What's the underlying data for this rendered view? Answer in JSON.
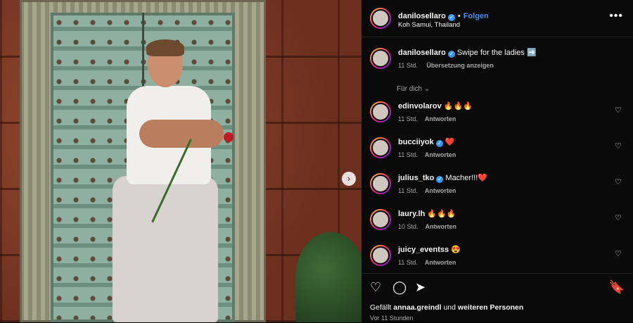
{
  "post": {
    "author": "danilosellaro",
    "follow_label": "Folgen",
    "location": "Koh Samui, Thailand",
    "caption_text": "Swipe for the ladies ➡️",
    "caption_time": "11 Std.",
    "translate_label": "Übersetzung anzeigen",
    "for_you_label": "Für dich ⌄",
    "more_label": "•••"
  },
  "comments": [
    {
      "user": "edinvolarov",
      "verified": false,
      "text": "🔥🔥🔥",
      "time": "11 Std.",
      "reply": "Antworten"
    },
    {
      "user": "bucciiyok",
      "verified": true,
      "text": "❤️",
      "time": "11 Std.",
      "reply": "Antworten"
    },
    {
      "user": "julius_tko",
      "verified": true,
      "text": "Macher!!!❤️",
      "time": "11 Std.",
      "reply": "Antworten"
    },
    {
      "user": "laury.lh",
      "verified": false,
      "text": "🔥🔥🔥",
      "time": "10 Std.",
      "reply": "Antworten"
    },
    {
      "user": "juicy_eventss",
      "verified": false,
      "text": "😍",
      "time": "11 Std.",
      "reply": "Antworten"
    }
  ],
  "footer": {
    "likes_prefix": "Gefällt",
    "likes_user": "annaa.greindl",
    "likes_mid": "und",
    "likes_others": "weiteren Personen",
    "timestamp": "Vor 11 Stunden"
  },
  "icons": {
    "heart": "♡",
    "comment": "◯",
    "share": "➤",
    "save": "🔖",
    "next": "›",
    "verified": "✓"
  },
  "colors": {
    "background": "#0a0a0a",
    "link": "#4a8ff0",
    "verified": "#3797f0",
    "muted": "#a8a8a8"
  }
}
